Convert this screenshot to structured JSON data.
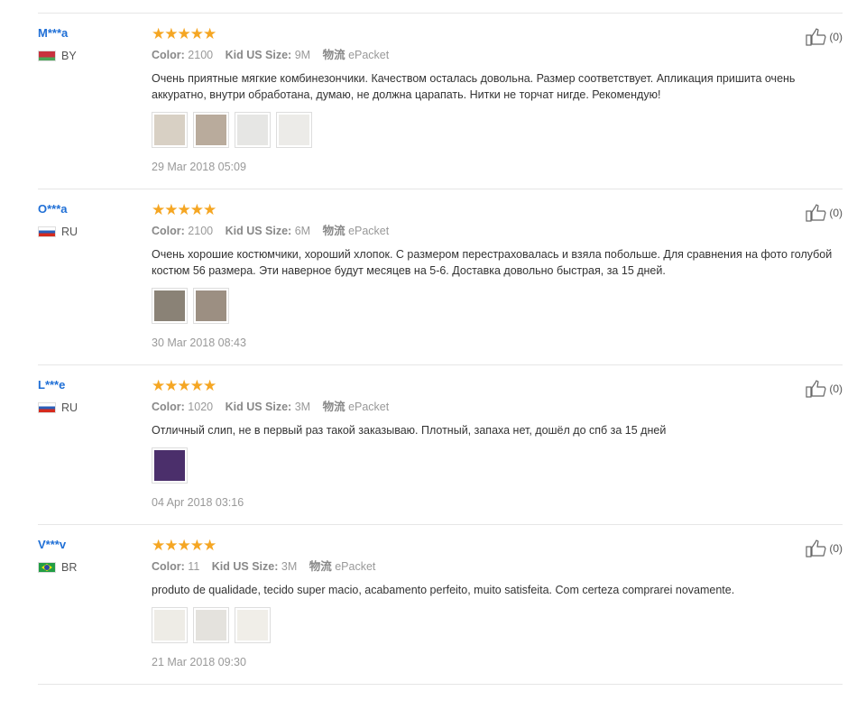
{
  "reviews": [
    {
      "user": "M***a",
      "country": "BY",
      "stars": "★★★★★",
      "color_label": "Color:",
      "color": "2100",
      "size_label": "Kid US Size:",
      "size": "9M",
      "shipping_label": "物流",
      "shipping": "ePacket",
      "text": "Очень приятные мягкие комбинезончики. Качеством осталась довольна. Размер соответствует. Апликация пришита очень аккуратно, внутри обработана, думаю, не должна царапать. Нитки не торчат нигде. Рекомендую!",
      "date": "29 Mar 2018 05:09",
      "helpful": "(0)",
      "photos": [
        "#d8d0c4",
        "#b9ab9c",
        "#e6e6e4",
        "#ecebe8"
      ]
    },
    {
      "user": "O***a",
      "country": "RU",
      "stars": "★★★★★",
      "color_label": "Color:",
      "color": "2100",
      "size_label": "Kid US Size:",
      "size": "6M",
      "shipping_label": "物流",
      "shipping": "ePacket",
      "text": "Очень хорошие костюмчики, хороший хлопок. С размером перестраховалась и взяла побольше. Для сравнения на фото голубой костюм 56 размера. Эти наверное будут месяцев на 5-6. Доставка довольно быстрая, за 15 дней.",
      "date": "30 Mar 2018 08:43",
      "helpful": "(0)",
      "photos": [
        "#8a8276",
        "#9c8f82"
      ]
    },
    {
      "user": "L***e",
      "country": "RU",
      "stars": "★★★★★",
      "color_label": "Color:",
      "color": "1020",
      "size_label": "Kid US Size:",
      "size": "3M",
      "shipping_label": "物流",
      "shipping": "ePacket",
      "text": "Отличный слип, не в первый раз такой заказываю. Плотный, запаха нет, дошёл до спб за 15 дней",
      "date": "04 Apr 2018 03:16",
      "helpful": "(0)",
      "photos": [
        "#4b2f6b"
      ]
    },
    {
      "user": "V***v",
      "country": "BR",
      "stars": "★★★★★",
      "color_label": "Color:",
      "color": "11",
      "size_label": "Kid US Size:",
      "size": "3M",
      "shipping_label": "物流",
      "shipping": "ePacket",
      "text": "produto de qualidade, tecido super macio, acabamento perfeito, muito satisfeita. Com certeza comprarei novamente.",
      "date": "21 Mar 2018 09:30",
      "helpful": "(0)",
      "photos": [
        "#eeece6",
        "#e4e2dd",
        "#f0eee8"
      ]
    }
  ]
}
